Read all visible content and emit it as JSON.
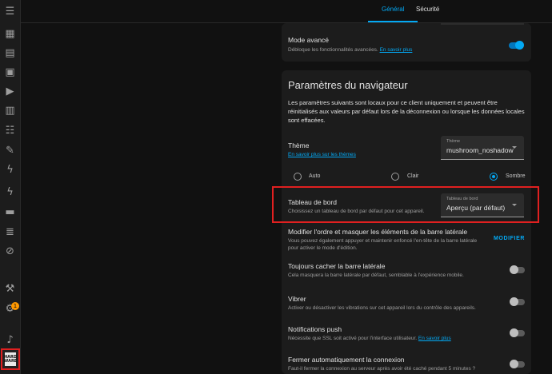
{
  "tabs": [
    {
      "label": "Général",
      "active": true
    },
    {
      "label": "Sécurité",
      "active": false
    }
  ],
  "sidebar": {
    "icons": [
      "menu-icon",
      "overview-icon",
      "energy-icon",
      "calendar-icon",
      "media-icon",
      "logbook-icon",
      "todo-list-icon",
      "tools-icon",
      "flash-icon",
      "flash-icon",
      "zwave-icon",
      "zigbee-icon",
      "compass-icon",
      "hammer-icon",
      "settings-icon",
      "bell-icon",
      "user-avatar"
    ],
    "settings_badge": "1",
    "avatar_text": "HARD WARE"
  },
  "advanced": {
    "title": "Mode avancé",
    "sub": "Débloque les fonctionnalités avancées.",
    "link": "En savoir plus",
    "enabled": true
  },
  "browser": {
    "heading": "Paramètres du navigateur",
    "description": "Les paramètres suivants sont locaux pour ce client uniquement et peuvent être réinitialisés aux valeurs par défaut lors de la déconnexion ou lorsque les données locales sont effacées.",
    "theme": {
      "title": "Thème",
      "link": "En savoir plus sur les thèmes",
      "select_label": "Thème",
      "select_value": "mushroom_noshadow",
      "modes": [
        {
          "label": "Auto",
          "checked": false
        },
        {
          "label": "Clair",
          "checked": false
        },
        {
          "label": "Sombre",
          "checked": true
        }
      ]
    },
    "dashboard": {
      "title": "Tableau de bord",
      "sub": "Choisissez un tableau de bord par défaut pour cet appareil.",
      "select_label": "Tableau de bord",
      "select_value": "Aperçu (par défaut)"
    },
    "sidebar_order": {
      "title": "Modifier l'ordre et masquer les éléments de la barre latérale",
      "sub": "Vous pouvez également appuyer et maintenir enfoncé l'en-tête de la barre latérale pour activer le mode d'édition.",
      "button": "MODIFIER"
    },
    "hide_sidebar": {
      "title": "Toujours cacher la barre latérale",
      "sub": "Cela masquera la barre latérale par défaut, semblable à l'expérience mobile.",
      "enabled": false
    },
    "vibrate": {
      "title": "Vibrer",
      "sub": "Activer ou désactiver les vibrations sur cet appareil lors du contrôle des appareils.",
      "enabled": false
    },
    "push": {
      "title": "Notifications push",
      "sub": "Nécessite que SSL soit activé pour l'interface utilisateur.",
      "link": "En savoir plus",
      "enabled": false
    },
    "auto_close": {
      "title": "Fermer automatiquement la connexion",
      "sub": "Faut-il fermer la connexion au serveur après avoir été caché pendant 5 minutes ?",
      "enabled": false
    }
  }
}
